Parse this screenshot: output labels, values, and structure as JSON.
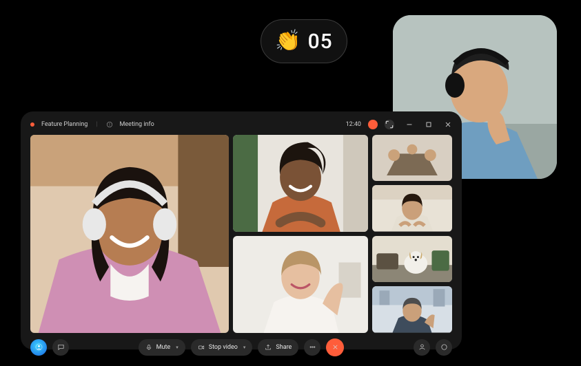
{
  "counter": {
    "emoji": "👏",
    "value": "05"
  },
  "window": {
    "title": "Feature Planning",
    "info_label": "Meeting info",
    "clock": "12:40"
  },
  "controls": {
    "mute": "Mute",
    "stop_video": "Stop video",
    "share": "Share"
  },
  "colors": {
    "accent": "#ff5d3a"
  }
}
